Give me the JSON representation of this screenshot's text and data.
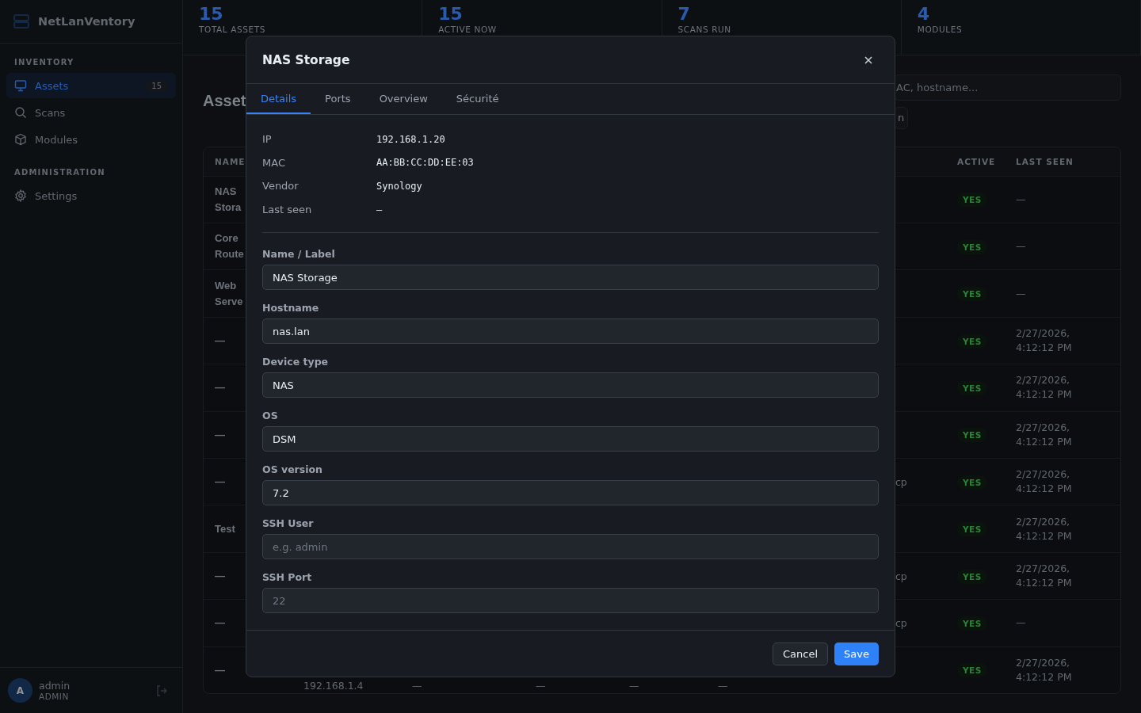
{
  "app": {
    "name": "NetLanVentory"
  },
  "sidebar": {
    "sections": [
      {
        "title": "INVENTORY",
        "items": [
          {
            "label": "Assets",
            "selected": true,
            "badge": "15"
          },
          {
            "label": "Scans",
            "selected": false
          },
          {
            "label": "Modules",
            "selected": false
          }
        ]
      },
      {
        "title": "ADMINISTRATION",
        "items": [
          {
            "label": "Settings",
            "selected": false
          }
        ]
      }
    ]
  },
  "user": {
    "initial": "A",
    "name": "admin",
    "role": "ADMIN"
  },
  "stats": [
    {
      "value": "15",
      "label": "TOTAL ASSETS"
    },
    {
      "value": "15",
      "label": "ACTIVE NOW"
    },
    {
      "value": "7",
      "label": "SCANS RUN"
    },
    {
      "value": "4",
      "label": "MODULES"
    }
  ],
  "page": {
    "title": "Asset",
    "search": {
      "placeholder": "AC, hostname..."
    },
    "button": "n"
  },
  "table": {
    "columns": {
      "name": "NAME",
      "active": "ACTIVE",
      "last_seen": "LAST SEEN"
    },
    "rows": [
      {
        "name": "NAS Stora",
        "active": "YES",
        "last_seen": "—"
      },
      {
        "name": "Core Route",
        "active": "YES",
        "last_seen": "—"
      },
      {
        "name": "Web Serve",
        "active": "YES",
        "last_seen": "—"
      },
      {
        "name": "—",
        "active": "YES",
        "last_seen": "2/27/2026, 4:12:12 PM"
      },
      {
        "name": "—",
        "active": "YES",
        "last_seen": "2/27/2026, 4:12:12 PM"
      },
      {
        "name": "—",
        "active": "YES",
        "last_seen": "2/27/2026, 4:12:12 PM"
      },
      {
        "name": "—",
        "column_7": "cp",
        "active": "YES",
        "last_seen": "2/27/2026, 4:12:12 PM"
      },
      {
        "name": "Test",
        "active": "YES",
        "last_seen": "2/27/2026, 4:12:12 PM"
      },
      {
        "name": "—",
        "column_7": "cp",
        "active": "YES",
        "last_seen": "2/27/2026, 4:12:12 PM"
      },
      {
        "name": "—",
        "column_7": "cp",
        "active": "YES",
        "last_seen": "—"
      },
      {
        "name": "—",
        "middle": [
          "192.168.1.4",
          "—",
          "—",
          "—",
          "—"
        ],
        "active": "YES",
        "last_seen": "2/27/2026, 4:12:12 PM"
      }
    ]
  },
  "dialog": {
    "title": "NAS Storage",
    "tabs": [
      {
        "label": "Details",
        "selected": true
      },
      {
        "label": "Ports",
        "selected": false
      },
      {
        "label": "Overview",
        "selected": false
      },
      {
        "label": "Sécurité",
        "selected": false
      }
    ],
    "info": [
      {
        "label": "IP",
        "value": "192.168.1.20"
      },
      {
        "label": "MAC",
        "value": "AA:BB:CC:DD:EE:03"
      },
      {
        "label": "Vendor",
        "value": "Synology"
      },
      {
        "label": "Last seen",
        "value": "—"
      }
    ],
    "fields": [
      {
        "label": "Name / Label",
        "value": "NAS Storage"
      },
      {
        "label": "Hostname",
        "value": "nas.lan"
      },
      {
        "label": "Device type",
        "value": "NAS"
      },
      {
        "label": "OS",
        "value": "DSM"
      },
      {
        "label": "OS version",
        "value": "7.2"
      },
      {
        "label": "SSH User",
        "placeholder": "e.g. admin"
      },
      {
        "label": "SSH Port",
        "placeholder": "22"
      }
    ],
    "cancel": "Cancel",
    "save": "Save"
  }
}
